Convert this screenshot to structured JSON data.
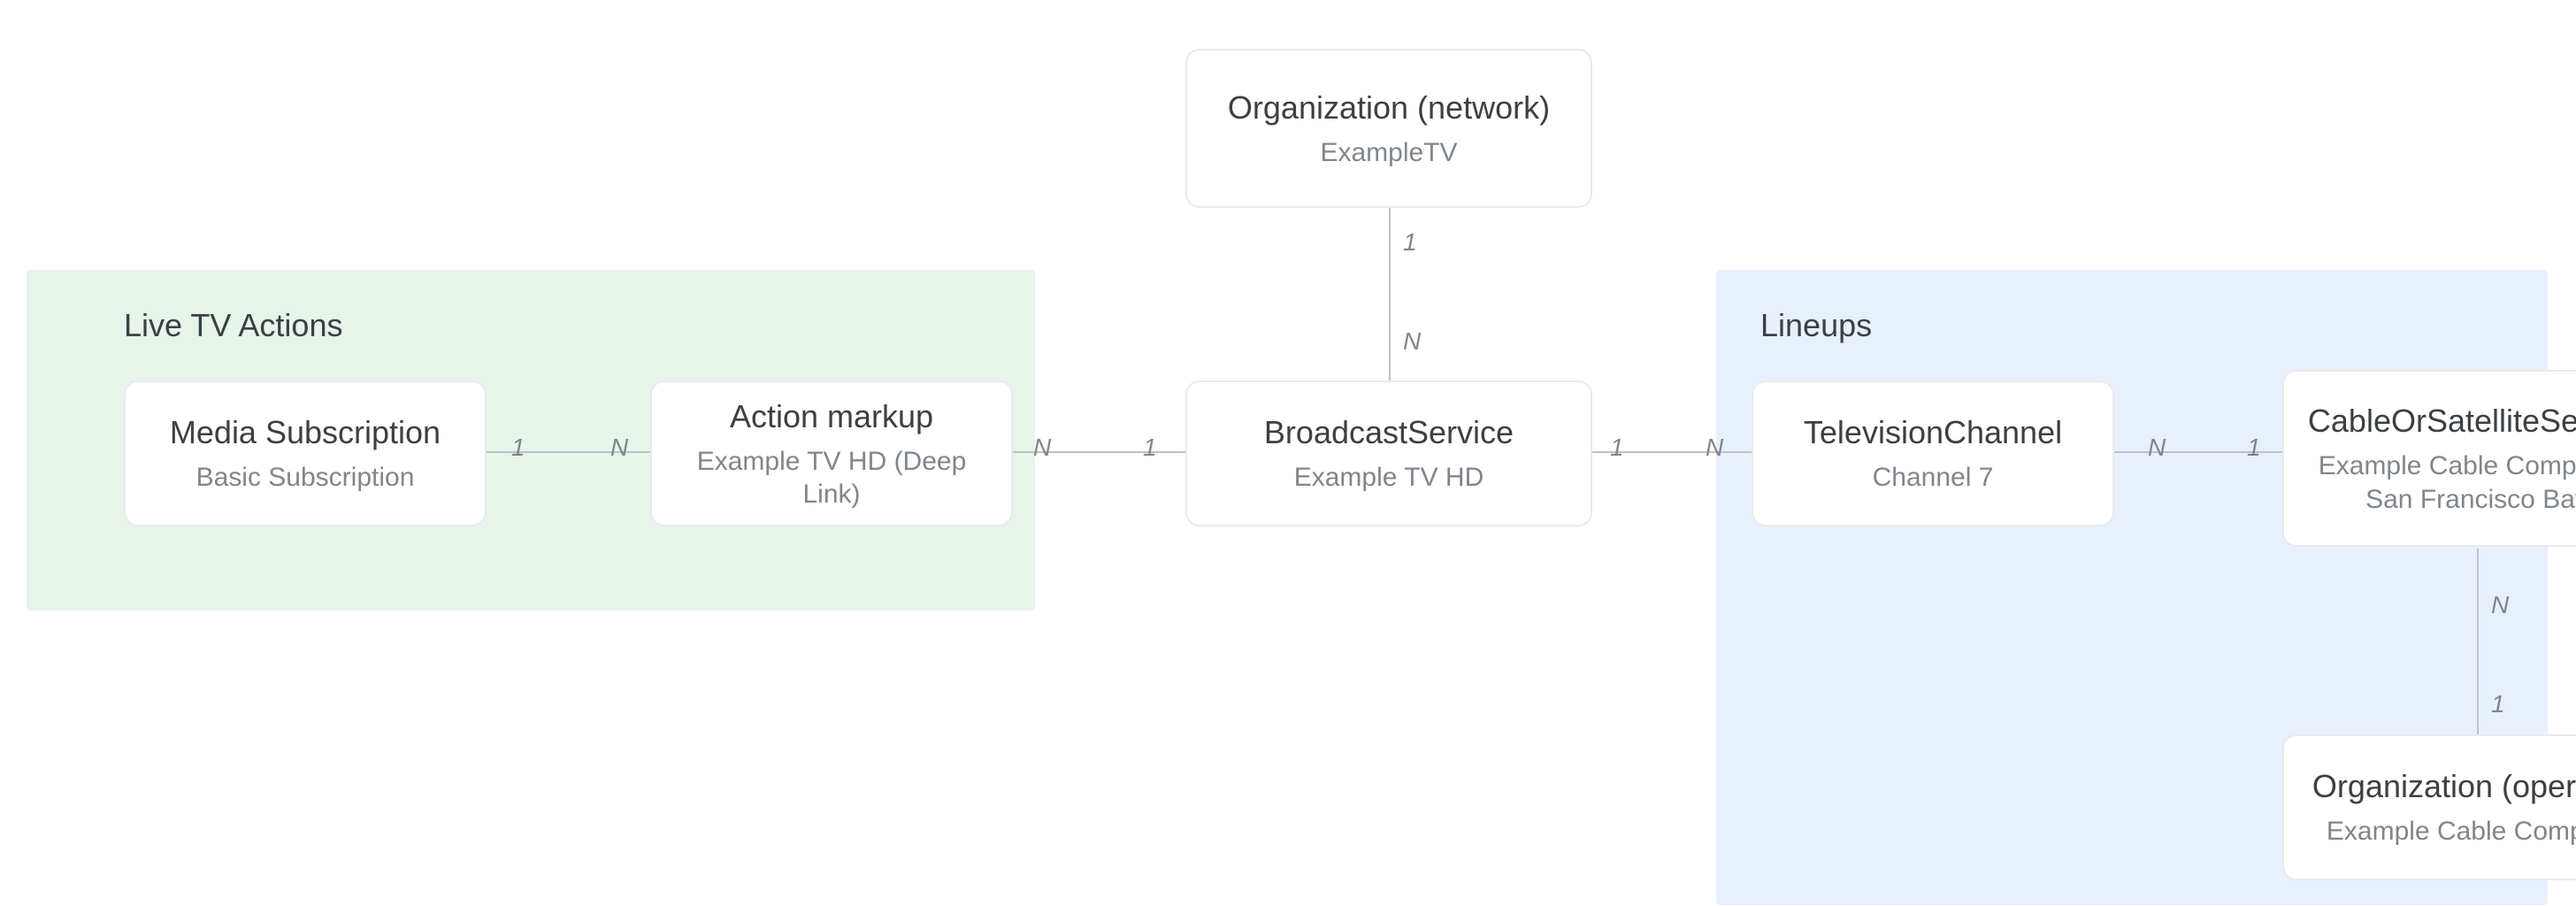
{
  "regions": {
    "live_tv": {
      "title": "Live TV Actions"
    },
    "lineups": {
      "title": "Lineups"
    }
  },
  "nodes": {
    "org_network": {
      "title": "Organization (network)",
      "sub": "ExampleTV"
    },
    "media_subscription": {
      "title": "Media Subscription",
      "sub": "Basic Subscription"
    },
    "action_markup": {
      "title": "Action markup",
      "sub": "Example TV HD (Deep Link)"
    },
    "broadcast_service": {
      "title": "BroadcastService",
      "sub": "Example TV HD"
    },
    "television_channel": {
      "title": "TelevisionChannel",
      "sub": "Channel 7"
    },
    "cable_service": {
      "title": "CableOrSatelliteService",
      "sub": "Example Cable Company - San Francisco Bay"
    },
    "org_operator": {
      "title": "Organization (operator)",
      "sub": "Example Cable Company"
    }
  },
  "cardinalities": {
    "one": "1",
    "n": "N"
  }
}
